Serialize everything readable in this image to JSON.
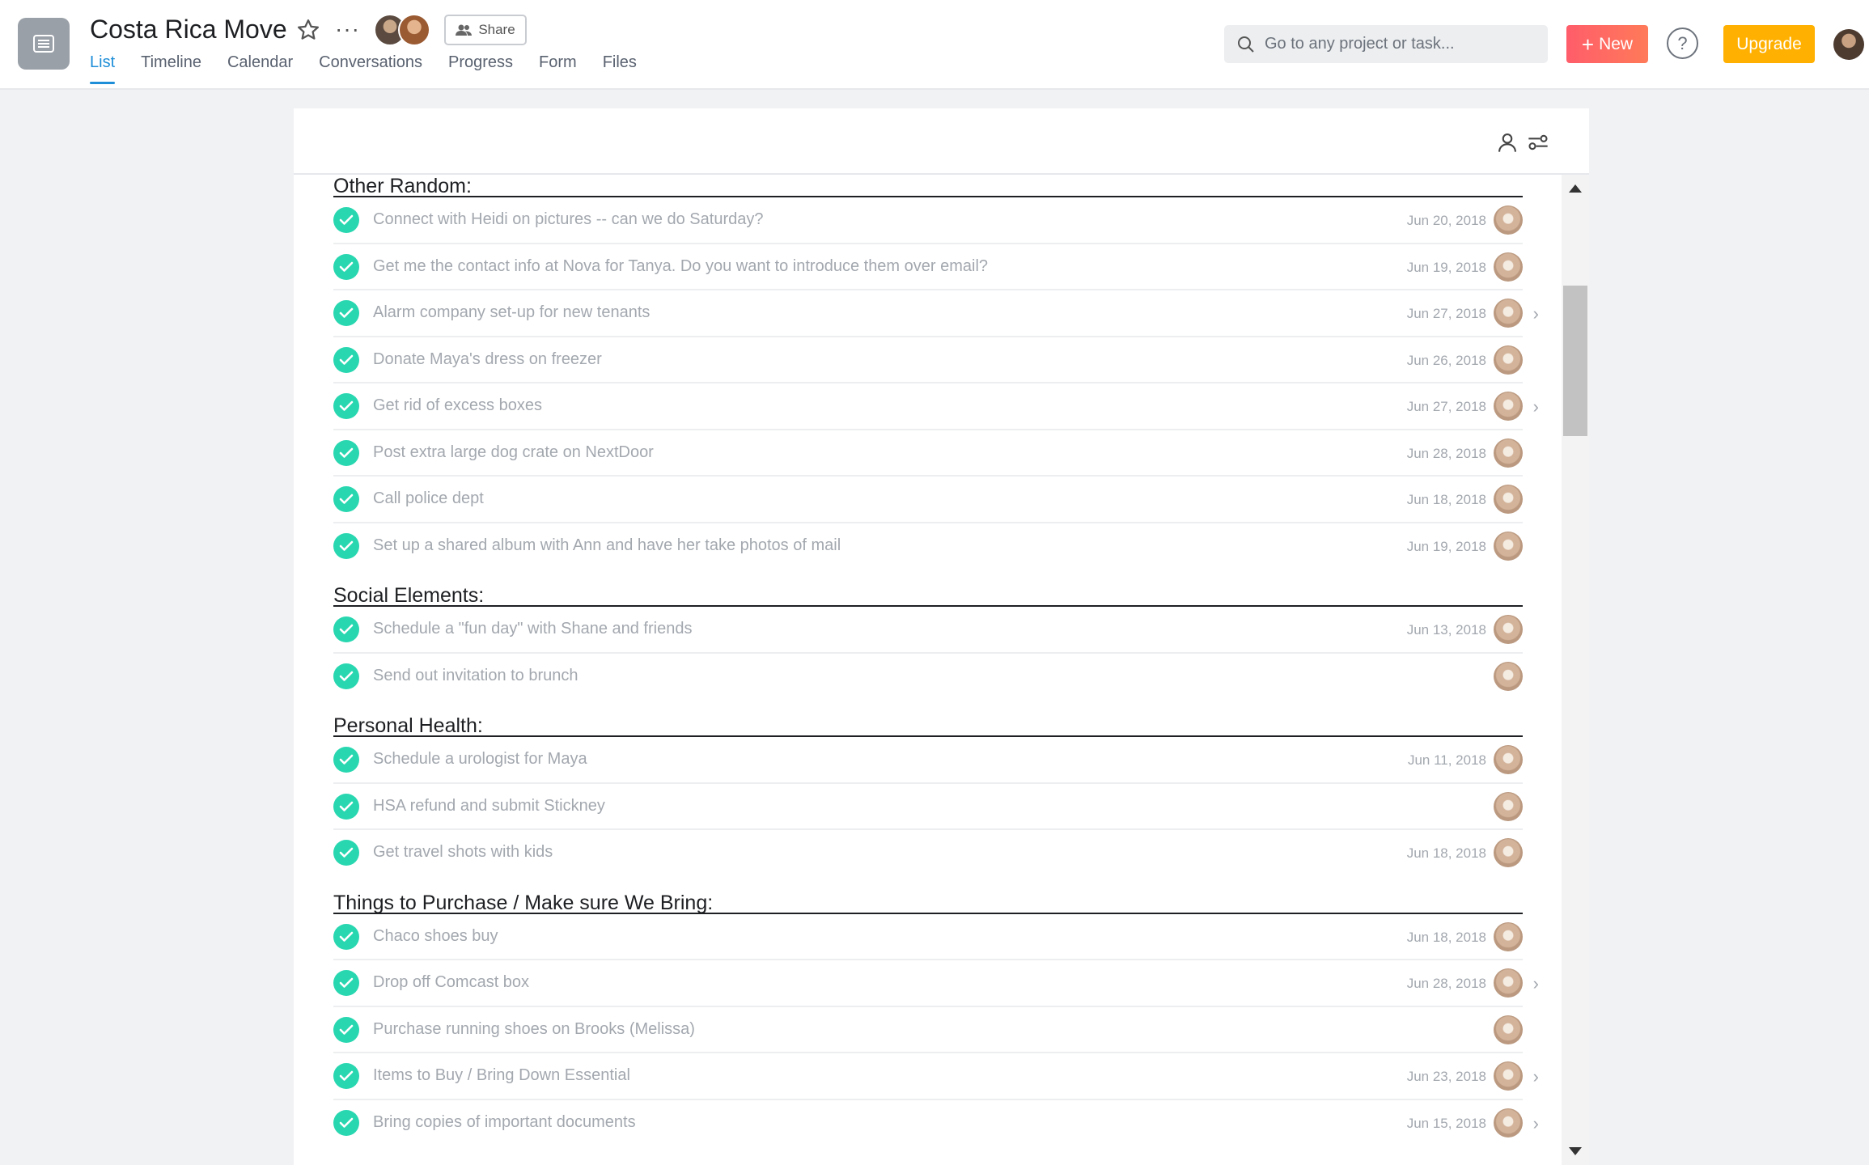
{
  "header": {
    "project_title": "Costa Rica Move",
    "share_label": "Share",
    "tabs": [
      "List",
      "Timeline",
      "Calendar",
      "Conversations",
      "Progress",
      "Form",
      "Files"
    ],
    "active_tab": "List",
    "search_placeholder": "Go to any project or task...",
    "new_label": "New",
    "help_label": "?",
    "upgrade_label": "Upgrade"
  },
  "colors": {
    "accent": "#1e8ed8",
    "check": "#28d7b0",
    "new_button": "#ff6b63",
    "upgrade_button": "#ffb000"
  },
  "sections": [
    {
      "title": "Other Random:",
      "tasks": [
        {
          "text": "Connect with Heidi on pictures -- can we do Saturday?",
          "date": "Jun 20, 2018",
          "chevron": false
        },
        {
          "text": "Get me the contact info at Nova for Tanya.  Do you want to introduce them over email?",
          "date": "Jun 19, 2018",
          "chevron": false
        },
        {
          "text": "Alarm company set-up for new tenants",
          "date": "Jun 27, 2018",
          "chevron": true
        },
        {
          "text": "Donate Maya's dress on freezer",
          "date": "Jun 26, 2018",
          "chevron": false
        },
        {
          "text": "Get rid of excess boxes",
          "date": "Jun 27, 2018",
          "chevron": true
        },
        {
          "text": "Post extra large dog crate on NextDoor",
          "date": "Jun 28, 2018",
          "chevron": false
        },
        {
          "text": "Call police dept",
          "date": "Jun 18, 2018",
          "chevron": false
        },
        {
          "text": "Set up a shared album with Ann and have her take photos of mail",
          "date": "Jun 19, 2018",
          "chevron": false
        }
      ]
    },
    {
      "title": "Social Elements:",
      "tasks": [
        {
          "text": "Schedule a \"fun day\" with Shane and friends",
          "date": "Jun 13, 2018",
          "chevron": false
        },
        {
          "text": "Send out invitation to brunch",
          "date": "",
          "chevron": false
        }
      ]
    },
    {
      "title": "Personal Health:",
      "tasks": [
        {
          "text": "Schedule a urologist for Maya",
          "date": "Jun 11, 2018",
          "chevron": false
        },
        {
          "text": "HSA refund and submit Stickney",
          "date": "",
          "chevron": false
        },
        {
          "text": "Get travel shots with kids",
          "date": "Jun 18, 2018",
          "chevron": false
        }
      ]
    },
    {
      "title": "Things to Purchase / Make sure We Bring:",
      "tasks": [
        {
          "text": "Chaco shoes buy",
          "date": "Jun 18, 2018",
          "chevron": false
        },
        {
          "text": "Drop off Comcast box",
          "date": "Jun 28, 2018",
          "chevron": true
        },
        {
          "text": "Purchase running shoes on Brooks (Melissa)",
          "date": "",
          "chevron": false
        },
        {
          "text": "Items to Buy / Bring Down Essential",
          "date": "Jun 23, 2018",
          "chevron": true
        },
        {
          "text": "Bring copies of important documents",
          "date": "Jun 15, 2018",
          "chevron": true
        }
      ]
    }
  ]
}
